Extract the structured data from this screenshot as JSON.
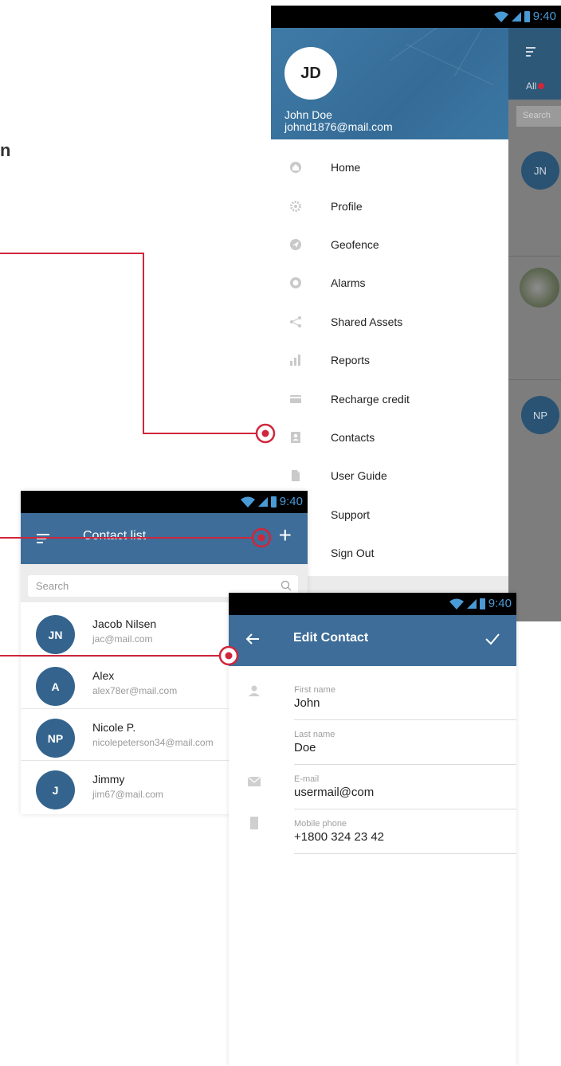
{
  "heading_fragment": "n",
  "status": {
    "time": "9:40"
  },
  "drawer": {
    "avatar_initials": "JD",
    "user_name": "John Doe",
    "user_email": "johnd1876@mail.com",
    "items": [
      {
        "label": "Home",
        "icon": "home-icon"
      },
      {
        "label": "Profile",
        "icon": "gear-icon"
      },
      {
        "label": "Geofence",
        "icon": "navigation-icon"
      },
      {
        "label": "Alarms",
        "icon": "alarm-icon"
      },
      {
        "label": "Shared Assets",
        "icon": "share-icon"
      },
      {
        "label": "Reports",
        "icon": "bar-chart-icon"
      },
      {
        "label": "Recharge credit",
        "icon": "credit-card-icon"
      },
      {
        "label": "Contacts",
        "icon": "contact-book-icon"
      },
      {
        "label": "User Guide",
        "icon": "document-icon"
      },
      {
        "label": "Support",
        "icon": "support-icon"
      },
      {
        "label": "Sign Out",
        "icon": "sign-out-icon"
      }
    ],
    "behind": {
      "tab": "All",
      "search": "Search",
      "avatars": [
        "JN",
        "NP"
      ]
    }
  },
  "contact_list": {
    "title": "Contact list",
    "search_placeholder": "Search",
    "contacts": [
      {
        "initials": "JN",
        "name": "Jacob Nilsen",
        "email": "jac@mail.com"
      },
      {
        "initials": "A",
        "name": "Alex",
        "email": "alex78er@mail.com"
      },
      {
        "initials": "NP",
        "name": "Nicole P.",
        "email": "nicolepeterson34@mail.com"
      },
      {
        "initials": "J",
        "name": "Jimmy",
        "email": "jim67@mail.com"
      }
    ]
  },
  "edit_contact": {
    "title": "Edit Contact",
    "fields": [
      {
        "label": "First name",
        "value": "John"
      },
      {
        "label": "Last name",
        "value": "Doe"
      },
      {
        "label": "E-mail",
        "value": "usermail@com"
      },
      {
        "label": "Mobile phone",
        "value": "+1800 324 23 42"
      }
    ]
  },
  "colors": {
    "primary": "#3d6d98",
    "accent_marker": "#d0263c",
    "status_text": "#4a9ad6"
  }
}
